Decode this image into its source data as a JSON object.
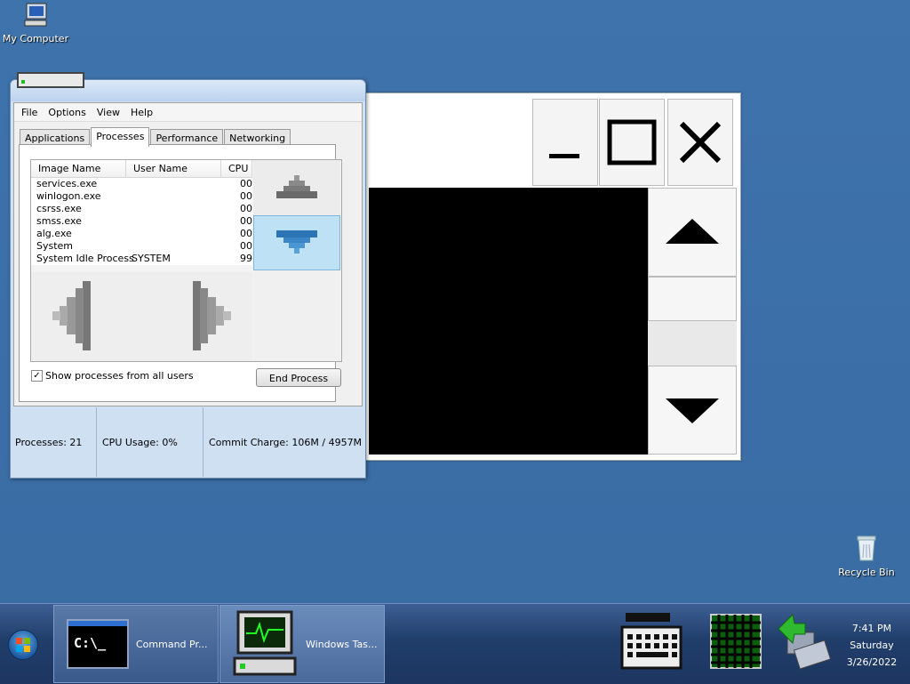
{
  "desktop": {
    "icons": [
      {
        "label": "My Computer",
        "icon": "computer-icon"
      },
      {
        "label": "Recycle Bin",
        "icon": "recycle-bin-icon"
      }
    ]
  },
  "taskmgr": {
    "menu": [
      "File",
      "Options",
      "View",
      "Help"
    ],
    "tabs": [
      "Applications",
      "Processes",
      "Performance",
      "Networking"
    ],
    "active_tab": "Processes",
    "columns": [
      "Image Name",
      "User Name",
      "CPU"
    ],
    "rows": [
      {
        "name": "services.exe",
        "user": "",
        "cpu": "00"
      },
      {
        "name": "winlogon.exe",
        "user": "",
        "cpu": "00"
      },
      {
        "name": "csrss.exe",
        "user": "",
        "cpu": "00"
      },
      {
        "name": "smss.exe",
        "user": "",
        "cpu": "00"
      },
      {
        "name": "alg.exe",
        "user": "",
        "cpu": "00"
      },
      {
        "name": "System",
        "user": "",
        "cpu": "00"
      },
      {
        "name": "System Idle Process",
        "user": "SYSTEM",
        "cpu": "99"
      }
    ],
    "show_all_label": "Show processes from all users",
    "show_all_checked": true,
    "end_process_label": "End Process",
    "status": {
      "processes": "Processes: 21",
      "cpu": "CPU Usage: 0%",
      "commit": "Commit Charge: 106M / 4957M"
    }
  },
  "taskbar": {
    "tasks": [
      {
        "label": "Command Pr...",
        "icon": "command-prompt-icon",
        "prompt": "C:\\_"
      },
      {
        "label": "Windows Tas...",
        "icon": "task-manager-icon"
      }
    ],
    "tray_icons": [
      "keyboard-icon",
      "network-grid-icon",
      "network-connection-icon"
    ],
    "clock": {
      "time": "7:41 PM",
      "day": "Saturday",
      "date": "3/26/2022"
    }
  },
  "colors": {
    "desktop": "#3a6ea5",
    "selection": "#bfe1f6",
    "taskbar": "#213e6a"
  }
}
